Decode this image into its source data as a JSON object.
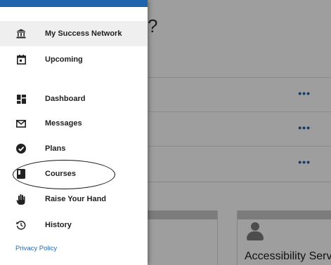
{
  "background": {
    "heading_fragment": "?",
    "row_actions": [
      "•••",
      "•••",
      "•••"
    ],
    "tile_label": "Accessibility Serv"
  },
  "menu": {
    "items": [
      {
        "id": "my-success-network",
        "label": "My Success Network",
        "icon": "bank-icon",
        "active": true
      },
      {
        "id": "upcoming",
        "label": "Upcoming",
        "icon": "calendar-icon",
        "active": false
      },
      {
        "id": "dashboard",
        "label": "Dashboard",
        "icon": "dashboard-icon",
        "active": false
      },
      {
        "id": "messages",
        "label": "Messages",
        "icon": "envelope-icon",
        "active": false
      },
      {
        "id": "plans",
        "label": "Plans",
        "icon": "check-circle-icon",
        "active": false
      },
      {
        "id": "courses",
        "label": "Courses",
        "icon": "book-icon",
        "active": false
      },
      {
        "id": "raise-your-hand",
        "label": "Raise Your Hand",
        "icon": "hand-icon",
        "active": false
      },
      {
        "id": "history",
        "label": "History",
        "icon": "history-icon",
        "active": false
      }
    ],
    "privacy_label": "Privacy Policy"
  },
  "colors": {
    "brand_bar": "#1f64ad",
    "link": "#2b67b2",
    "active_item_bg": "#efefef"
  }
}
